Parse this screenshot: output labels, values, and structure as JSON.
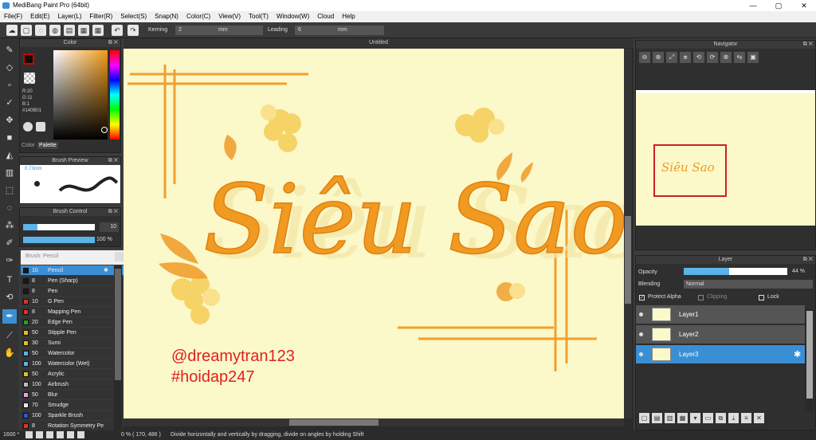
{
  "app": {
    "title": "MediBang Paint Pro (64bit)"
  },
  "menu": [
    "File(F)",
    "Edit(E)",
    "Layer(L)",
    "Filter(R)",
    "Select(S)",
    "Snap(N)",
    "Color(C)",
    "View(V)",
    "Tool(T)",
    "Window(W)",
    "Cloud",
    "Help"
  ],
  "toolbar": {
    "kerning_label": "Kerning",
    "kerning_value": "2",
    "kerning_unit": "mm",
    "leading_label": "Leading",
    "leading_value": "6",
    "leading_unit": "mm"
  },
  "color_panel": {
    "title": "Color",
    "r": "R:20",
    "g": "G:11",
    "b": "B:1",
    "hex": "#140B01",
    "tab_color": "Color",
    "tab_palette": "Palette",
    "current_color": "#cc0000"
  },
  "brush_preview": {
    "title": "Brush Preview",
    "size": "0.73mm"
  },
  "brush_control": {
    "title": "Brush Control",
    "size_value": "10",
    "opacity_value": "100 %"
  },
  "brush_panel": {
    "title": "Brush: Pencil"
  },
  "brushes": [
    {
      "size": "10",
      "name": "Pencil",
      "color": "#1a1a1a",
      "selected": true
    },
    {
      "size": "8",
      "name": "Pen (Sharp)",
      "color": "#1a1a1a"
    },
    {
      "size": "8",
      "name": "Pen",
      "color": "#1a1a1a"
    },
    {
      "size": "10",
      "name": "G Pen",
      "color": "#e03030"
    },
    {
      "size": "8",
      "name": "Mapping Pen",
      "color": "#e03030"
    },
    {
      "size": "20",
      "name": "Edge Pen",
      "color": "#28a028"
    },
    {
      "size": "50",
      "name": "Stipple Pen",
      "color": "#e0c020"
    },
    {
      "size": "30",
      "name": "Sumi",
      "color": "#e0c020"
    },
    {
      "size": "50",
      "name": "Watercolor",
      "color": "#5ab4ea"
    },
    {
      "size": "100",
      "name": "Watercolor (Wet)",
      "color": "#5ab4ea"
    },
    {
      "size": "50",
      "name": "Acrylic",
      "color": "#e0c020"
    },
    {
      "size": "100",
      "name": "Airbrush",
      "color": "#bbbbbb"
    },
    {
      "size": "50",
      "name": "Blur",
      "color": "#f0a0e0"
    },
    {
      "size": "70",
      "name": "Smudge",
      "color": "#e8e8e8"
    },
    {
      "size": "100",
      "name": "Sparkle Brush",
      "color": "#3050e0"
    },
    {
      "size": "8",
      "name": "Rotation Symmetry Pe",
      "color": "#e03030"
    }
  ],
  "canvas": {
    "title": "Untitled",
    "main_text": "Siêu Sao",
    "watermark1": "@dreamytran123",
    "watermark2": "#hoidap247"
  },
  "navigator": {
    "title": "Navigator"
  },
  "layer_panel": {
    "title": "Layer",
    "opacity_label": "Opacity",
    "opacity_value": "44 %",
    "opacity_level": 0.44,
    "blending_label": "Blending",
    "blending_value": "Normal",
    "protect_alpha": "Protect Alpha",
    "clipping": "Clipping",
    "lock": "Lock",
    "layers": [
      "Layer1",
      "Layer2",
      "Layer3"
    ]
  },
  "status": {
    "zoom": "1600 *",
    "coords": "0 % ( 170, 486 )",
    "hint": "Divide horizontally and vertically by dragging, divide on angles  by holding Shift"
  }
}
